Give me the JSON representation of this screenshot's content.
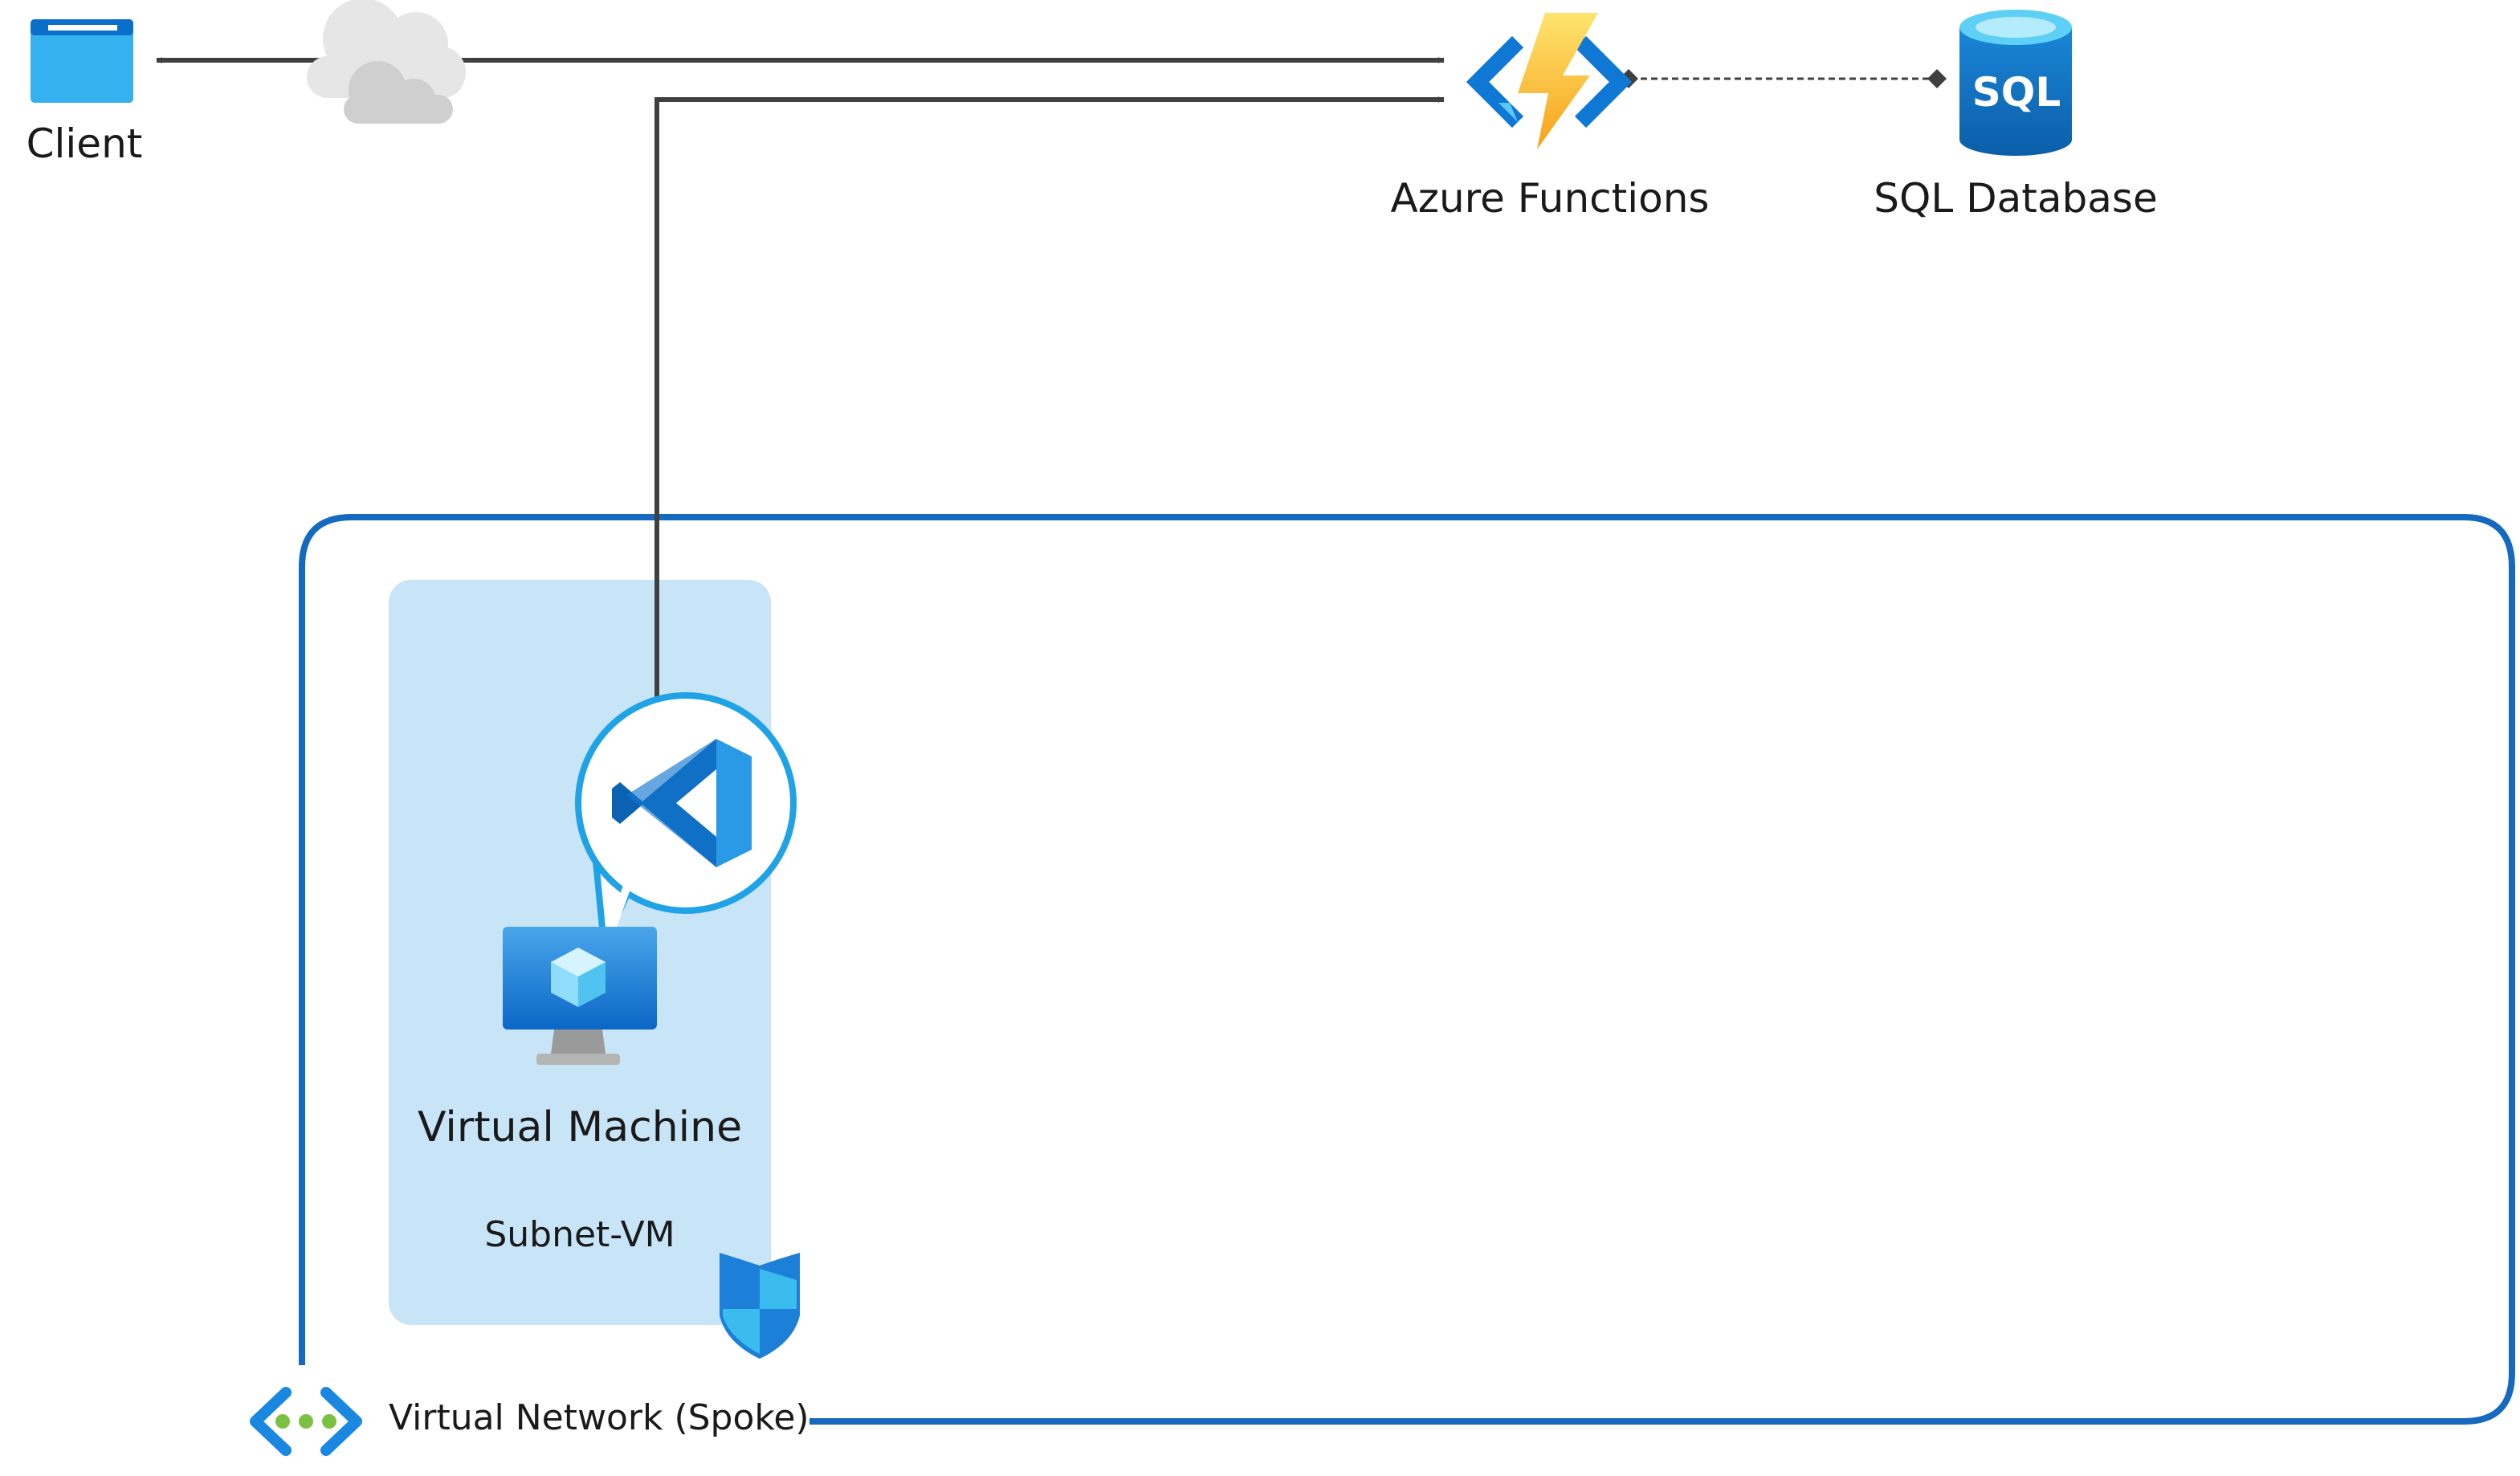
{
  "labels": {
    "client": "Client",
    "functions": "Azure Functions",
    "sql": "SQL Database",
    "vm": "Virtual Machine",
    "subnet": "Subnet-VM",
    "vnet": "Virtual Network (Spoke)",
    "sql_icon": "SQL"
  },
  "icons": {
    "client": "browser-window-icon",
    "internet": "cloud-icon",
    "functions": "azure-functions-icon",
    "sql": "sql-database-icon",
    "vm": "virtual-machine-icon",
    "vscode": "vscode-icon",
    "nsg": "shield-icon",
    "vnet": "virtual-network-icon"
  },
  "colors": {
    "vnet_border": "#1569bf",
    "subnet_fill": "#c8e5f8",
    "connector": "#404040",
    "azure_blue": "#0078d4",
    "lightning": "#fcbf1f",
    "vscode_callout": "#1fa3e6",
    "vnet_dots": "#7ac143"
  }
}
